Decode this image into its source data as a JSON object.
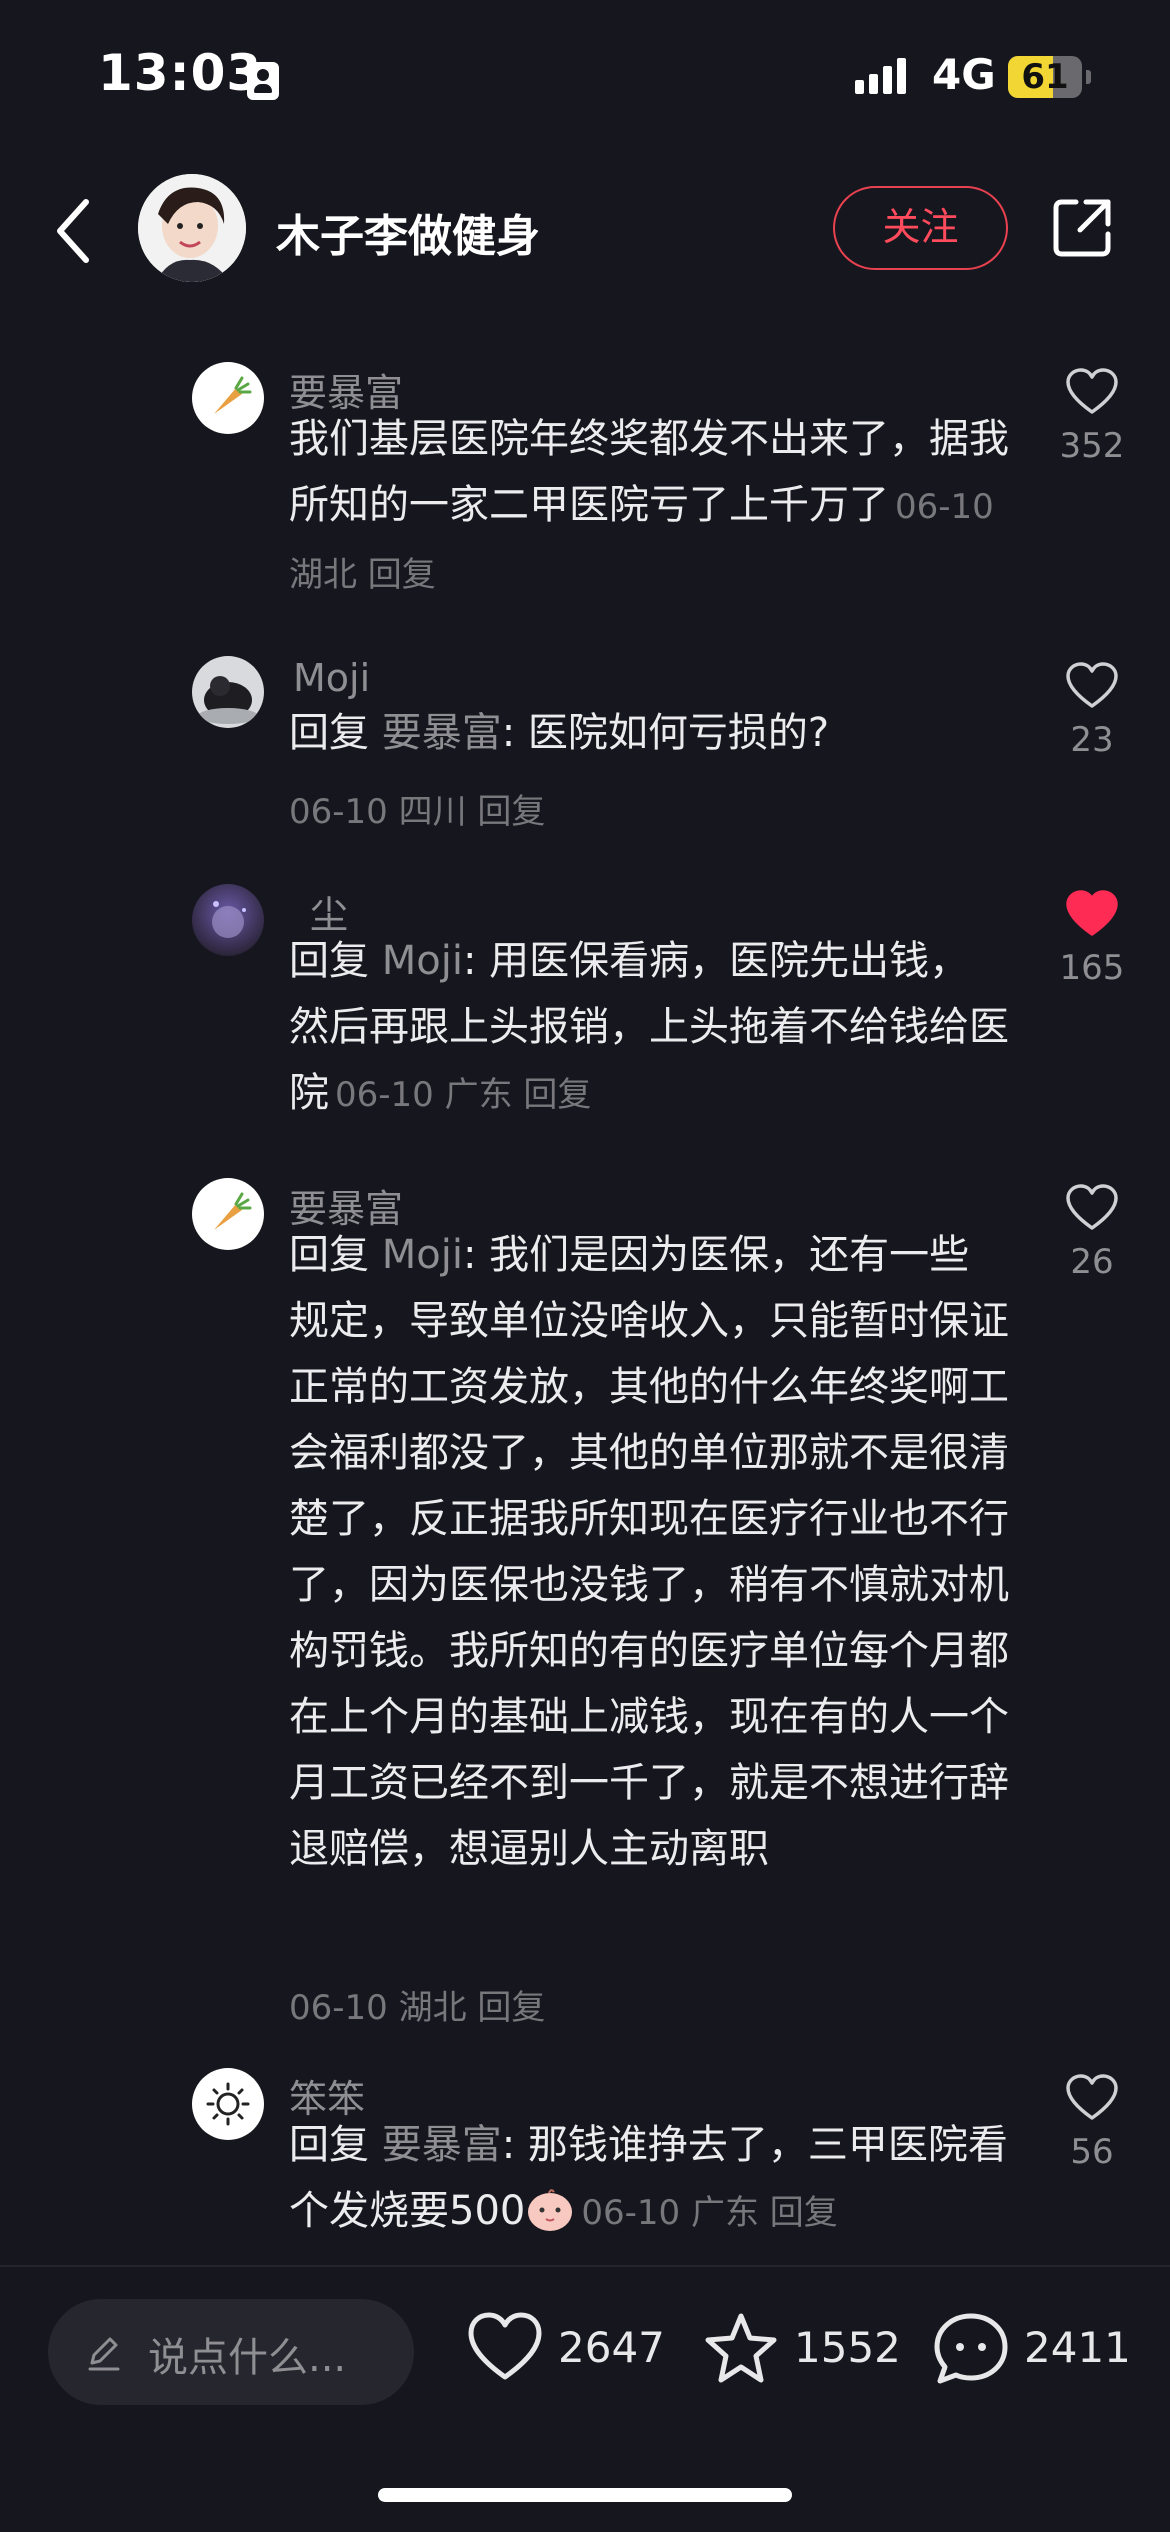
{
  "status_bar": {
    "time": "13:03",
    "network": "4G",
    "battery": "61",
    "battery_level": 0.61
  },
  "header": {
    "author": "木子李做健身",
    "follow_label": "关注"
  },
  "comments": [
    {
      "name": "要暴富",
      "text": "我们基层医院年终奖都发不出来了，据我所知的一家二甲医院亏了上千万了",
      "meta": "06-10 湖北 回复",
      "likes": "352",
      "liked": false
    },
    {
      "name": "Moji",
      "reply_prefix": "回复 ",
      "reply_to": "要暴富",
      "text": ": 医院如何亏损的?",
      "meta": "06-10 四川 回复",
      "likes": "23",
      "liked": false
    },
    {
      "name": "尘",
      "reply_prefix": "回复 ",
      "reply_to": "Moji",
      "text": ": 用医保看病，医院先出钱，然后再跟上头报销，上头拖着不给钱给医院",
      "meta": "06-10 广东 回复",
      "likes": "165",
      "liked": true
    },
    {
      "name": "要暴富",
      "reply_prefix": "回复 ",
      "reply_to": "Moji",
      "text": ": 我们是因为医保，还有一些规定，导致单位没啥收入，只能暂时保证正常的工资发放，其他的什么年终奖啊工会福利都没了，其他的单位那就不是很清楚了，反正据我所知现在医疗行业也不行了，因为医保也没钱了，稍有不慎就对机构罚钱。我所知的有的医疗单位每个月都在上个月的基础上减钱，现在有的人一个月工资已经不到一千了，就是不想进行辞退赔偿，想逼别人主动离职",
      "meta": "06-10 湖北 回复",
      "likes": "26",
      "liked": false
    },
    {
      "name": "笨笨",
      "reply_prefix": "回复 ",
      "reply_to": "要暴富",
      "text": ": 那钱谁挣去了，三甲医院看个发烧要500",
      "meta": "06-10 广东 回复",
      "likes": "56",
      "liked": false
    }
  ],
  "bottom_bar": {
    "input_placeholder": "说点什么...",
    "likes": "2647",
    "favorites": "1552",
    "comments": "2411"
  },
  "colors": {
    "accent": "#ff4b5c",
    "liked": "#fe2c55",
    "background": "#16161e"
  }
}
